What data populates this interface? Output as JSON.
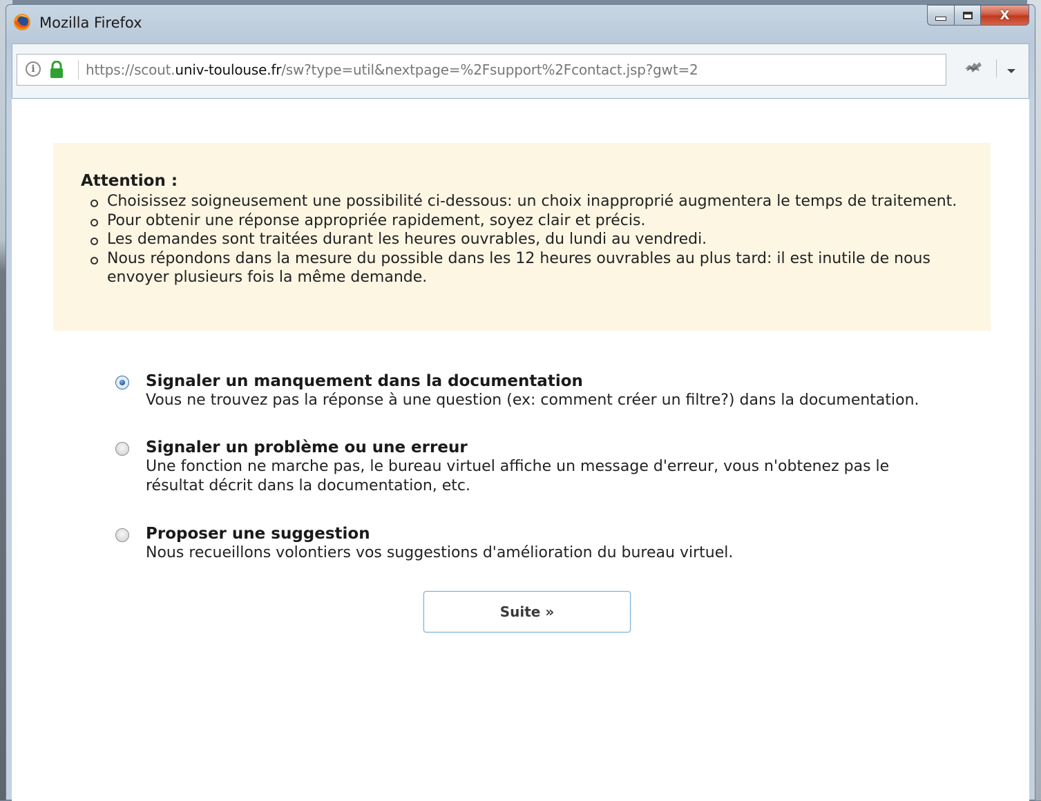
{
  "window": {
    "title": "Mozilla Firefox",
    "close_label": "X"
  },
  "urlbar": {
    "info_glyph": "i",
    "url_prefix": "https://scout.",
    "url_domain": "univ-toulouse.fr",
    "url_suffix": "/sw?type=util&nextpage=%2Fsupport%2Fcontact.jsp?gwt=2"
  },
  "notice": {
    "title": "Attention :",
    "items": [
      "Choisissez soigneusement une possibilité ci-dessous: un choix inapproprié augmentera le temps de traitement.",
      "Pour obtenir une réponse appropriée rapidement, soyez clair et précis.",
      "Les demandes sont traitées durant les heures ouvrables, du lundi au vendredi.",
      "Nous répondons dans la mesure du possible dans les 12 heures ouvrables au plus tard: il est inutile de nous envoyer plusieurs fois la même demande."
    ]
  },
  "options": [
    {
      "title": "Signaler un manquement dans la documentation",
      "description": "Vous ne trouvez pas la réponse à une question (ex: comment créer un filtre?) dans la documentation.",
      "selected": true
    },
    {
      "title": "Signaler un problème ou une erreur",
      "description": "Une fonction ne marche pas, le bureau virtuel affiche un message d'erreur, vous n'obtenez pas le résultat décrit dans la documentation, etc.",
      "selected": false
    },
    {
      "title": "Proposer une suggestion",
      "description": "Nous recueillons volontiers vos suggestions d'amélioration du bureau virtuel.",
      "selected": false
    }
  ],
  "button": {
    "label": "Suite »"
  },
  "colors": {
    "notice_bg": "#fcf6e3",
    "lock_green": "#2fa12f",
    "radio_selected": "#2a63a6",
    "button_border": "#7fb1d9"
  },
  "icons": {
    "app": "firefox-logo-icon",
    "info": "info-icon",
    "lock": "lock-icon",
    "extension": "puzzle-icon",
    "menu": "chevron-down-icon"
  }
}
